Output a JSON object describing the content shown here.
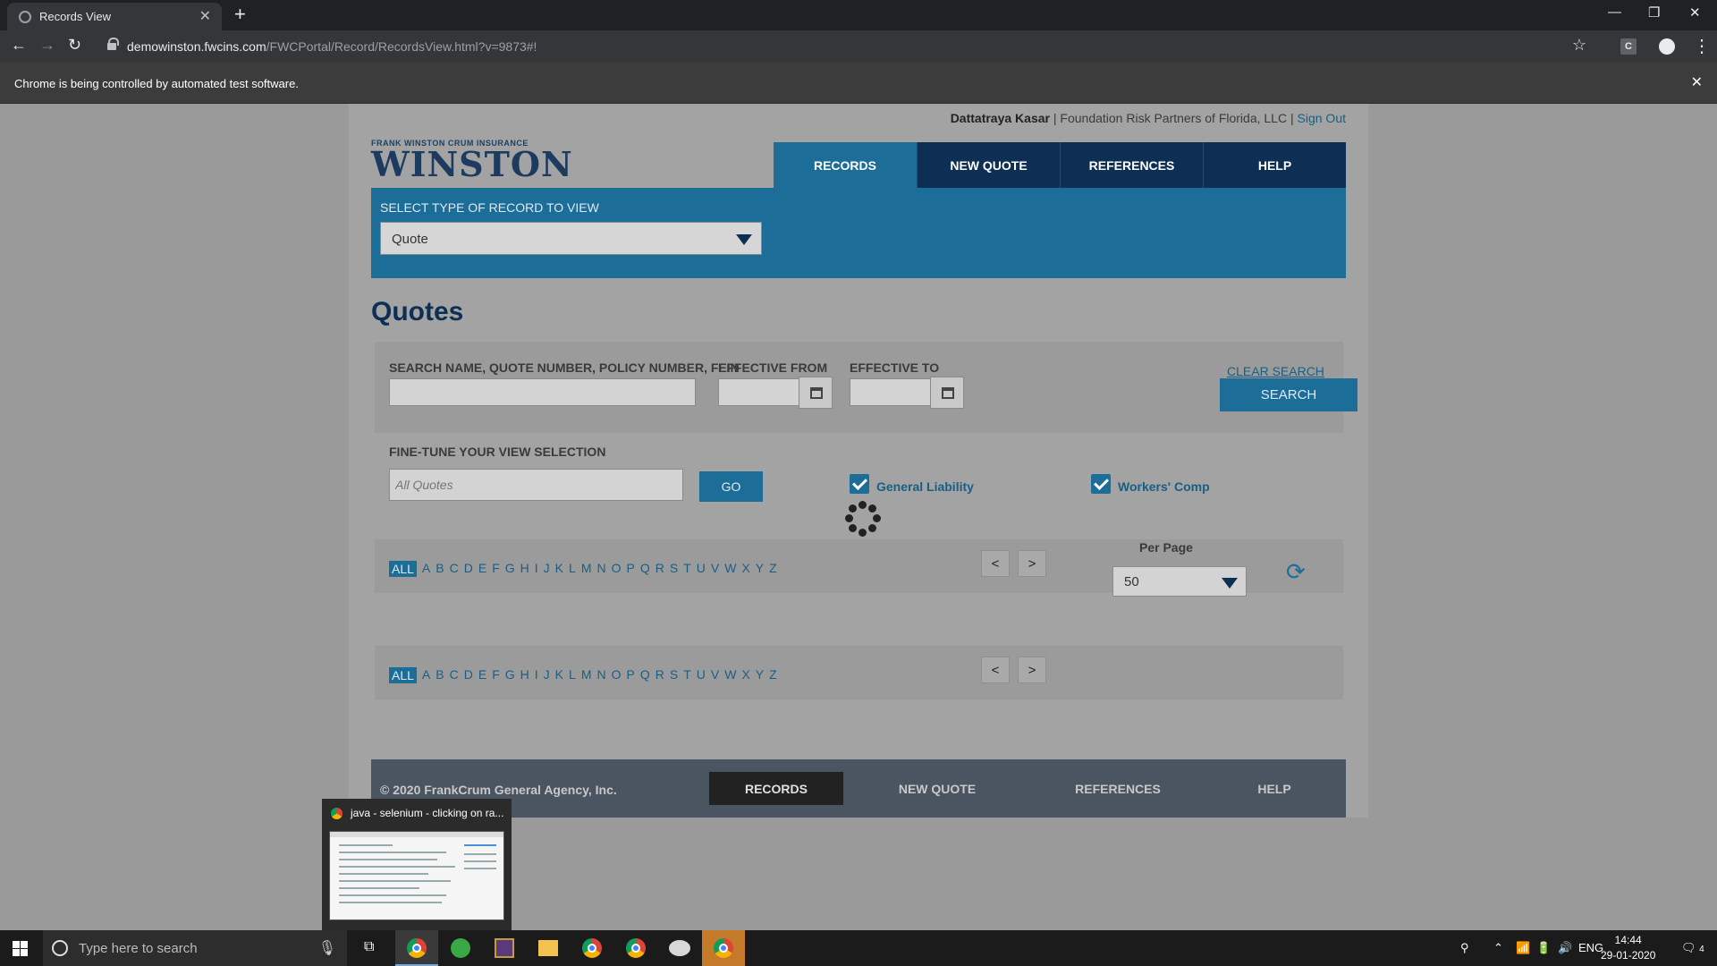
{
  "browser": {
    "tab_title": "Records View",
    "url_host": "demowinston.fwcins.com",
    "url_path": "/FWCPortal/Record/RecordsView.html?v=9873#!",
    "infobar_message": "Chrome is being controlled by automated test software.",
    "ext_label": "C"
  },
  "header": {
    "user_name": "Dattatraya Kasar",
    "separator": " | ",
    "company": "Foundation Risk Partners of Florida, LLC",
    "sign_out": "Sign Out",
    "logo_small": "FRANK WINSTON CRUM INSURANCE",
    "logo_big": "WINSTON"
  },
  "nav": {
    "items": [
      {
        "label": "RECORDS",
        "active": true
      },
      {
        "label": "NEW QUOTE",
        "active": false
      },
      {
        "label": "REFERENCES",
        "active": false
      },
      {
        "label": "HELP",
        "active": false
      }
    ]
  },
  "record_type": {
    "label": "SELECT TYPE OF RECORD TO VIEW",
    "selected": "Quote"
  },
  "main": {
    "heading": "Quotes"
  },
  "search": {
    "name_label": "SEARCH NAME, QUOTE NUMBER, POLICY NUMBER, FEIN",
    "name_value": "",
    "effective_from_label": "EFFECTIVE FROM",
    "effective_from_value": "",
    "effective_to_label": "EFFECTIVE TO",
    "effective_to_value": "",
    "clear_label": "CLEAR SEARCH",
    "search_button": "SEARCH"
  },
  "finetune": {
    "label": "FINE-TUNE YOUR VIEW SELECTION",
    "placeholder": "All Quotes",
    "go_button": "GO",
    "general_liability": {
      "label": "General Liability",
      "checked": true
    },
    "workers_comp": {
      "label": "Workers' Comp",
      "checked": true
    }
  },
  "alphabet": {
    "all_label": "ALL",
    "letters": [
      "A",
      "B",
      "C",
      "D",
      "E",
      "F",
      "G",
      "H",
      "I",
      "J",
      "K",
      "L",
      "M",
      "N",
      "O",
      "P",
      "Q",
      "R",
      "S",
      "T",
      "U",
      "V",
      "W",
      "X",
      "Y",
      "Z"
    ]
  },
  "pagination": {
    "prev": "<",
    "next": ">",
    "per_page_label": "Per Page",
    "per_page_value": "50"
  },
  "footer": {
    "copyright": "© 2020 FrankCrum General Agency, Inc.",
    "items": [
      {
        "label": "RECORDS",
        "active": true
      },
      {
        "label": "NEW QUOTE",
        "active": false
      },
      {
        "label": "REFERENCES",
        "active": false
      },
      {
        "label": "HELP",
        "active": false
      }
    ]
  },
  "taskbar_preview": {
    "title": "java - selenium - clicking on ra..."
  },
  "taskbar": {
    "search_placeholder": "Type here to search",
    "language": "ENG",
    "time": "14:44",
    "date": "29-01-2020",
    "notification_count": "4"
  }
}
